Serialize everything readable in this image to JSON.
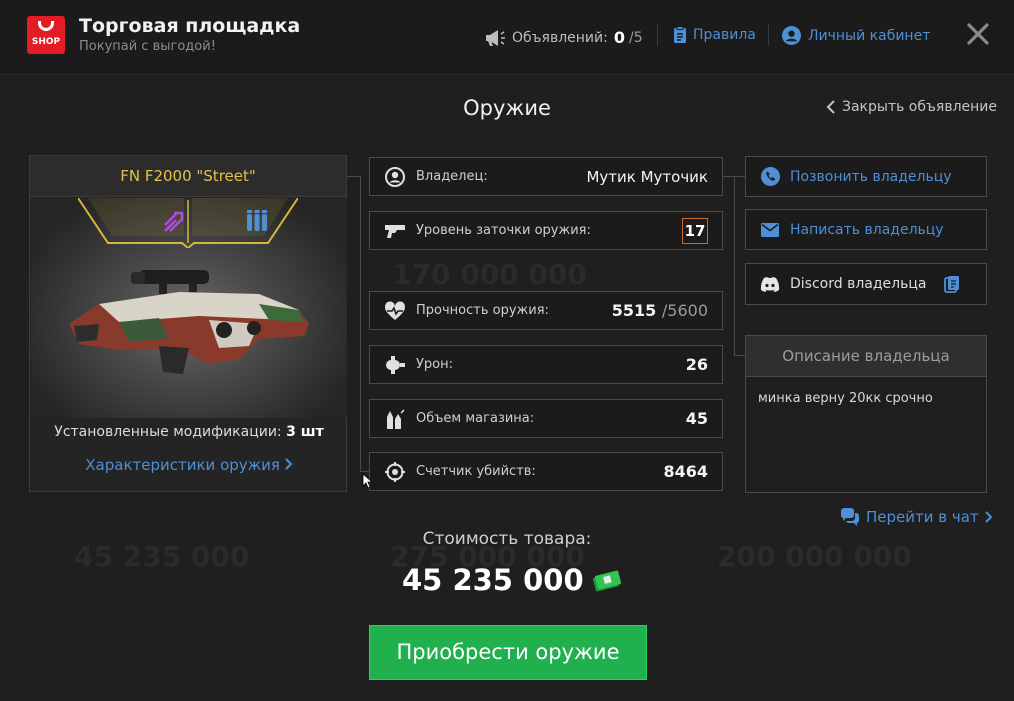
{
  "header": {
    "logo_text": "SHOP",
    "title": "Торговая площадка",
    "subtitle": "Покупай с выгодой!",
    "ads_label": "Объявлений:",
    "ads_count": "0",
    "ads_max": "/5",
    "rules_label": "Правила",
    "account_label": "Личный кабинет"
  },
  "page": {
    "title": "Оружие",
    "close_ad_label": "Закрыть объявление"
  },
  "item": {
    "name": "FN F2000 \"Street\"",
    "mods_label": "Установленные модификации:",
    "mods_count": "3 шт",
    "characteristics_link": "Характеристики оружия"
  },
  "stats": {
    "owner_label": "Владелец:",
    "owner_value": "Мутик Муточик",
    "level_label": "Уровень заточки оружия:",
    "level_value": "17",
    "durability_label": "Прочность оружия:",
    "durability_value": "5515",
    "durability_max": "/5600",
    "damage_label": "Урон:",
    "damage_value": "26",
    "magazine_label": "Объем магазина:",
    "magazine_value": "45",
    "kills_label": "Счетчик убийств:",
    "kills_value": "8464"
  },
  "contact": {
    "call_label": "Позвонить владельцу",
    "write_label": "Написать владельцу",
    "discord_label": "Discord владельца",
    "description_title": "Описание владельца",
    "description_text": "минка верну 20кк срочно",
    "chat_link": "Перейти в чат"
  },
  "purchase": {
    "price_label": "Стоимость товара:",
    "price_value": "45 235 000",
    "buy_label": "Приобрести оружие"
  },
  "background_ghosts": {
    "price_a": "170 000 000",
    "price_b": "45 235 000",
    "price_c": "275 000 000",
    "price_d": "200 000 000"
  },
  "colors": {
    "accent_blue": "#4e8fd6",
    "buy_green": "#21b04e",
    "item_gold": "#e6c14a",
    "brand_red": "#e31d25"
  }
}
